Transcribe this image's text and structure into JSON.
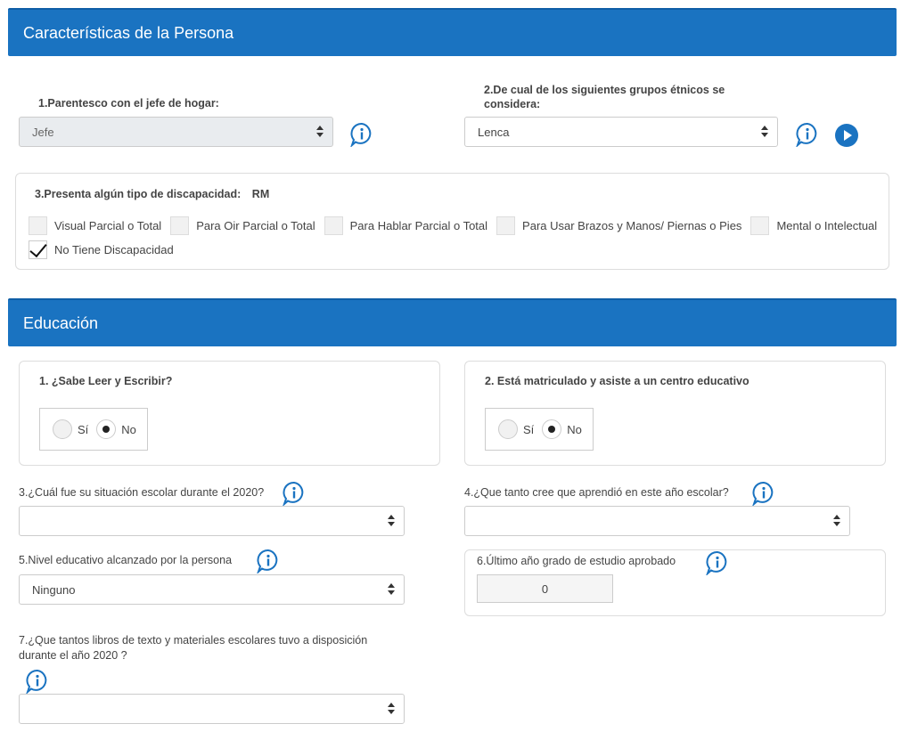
{
  "section1": {
    "title": "Características de la Persona",
    "q1": {
      "label": "1.Parentesco con el jefe de hogar:",
      "value": "Jefe"
    },
    "q2": {
      "label_line1": "2.De cual de los siguientes grupos étnicos se",
      "label_line2": "considera:",
      "value": "Lenca"
    },
    "q3": {
      "label": "3.Presenta algún tipo de discapacidad:",
      "badge": "RM",
      "options": [
        {
          "label": "Visual Parcial o Total",
          "checked": false
        },
        {
          "label": "Para Oir Parcial o Total",
          "checked": false
        },
        {
          "label": "Para Hablar Parcial o Total",
          "checked": false
        },
        {
          "label": "Para Usar Brazos y Manos/ Piernas o Pies",
          "checked": false
        },
        {
          "label": "Mental o Intelectual",
          "checked": false
        },
        {
          "label": "No Tiene Discapacidad",
          "checked": true
        }
      ]
    }
  },
  "section2": {
    "title": "Educación",
    "q1": {
      "label": "1. ¿Sabe Leer y Escribir?",
      "yes": "Sí",
      "no": "No",
      "selected": "No"
    },
    "q2": {
      "label": "2. Está matriculado y asiste a un centro educativo",
      "yes": "Sí",
      "no": "No",
      "selected": "No"
    },
    "q3": {
      "label": "3.¿Cuál fue su situación escolar durante el 2020?",
      "value": ""
    },
    "q4": {
      "label": "4.¿Que tanto cree que aprendió en este año escolar?",
      "value": ""
    },
    "q5": {
      "label": "5.Nivel educativo alcanzado por la persona",
      "value": "Ninguno"
    },
    "q6": {
      "label": "6.Último año grado de estudio aprobado",
      "value": "0"
    },
    "q7": {
      "label_line1": "7.¿Que tantos libros de texto y materiales escolares tuvo a disposición",
      "label_line2": "durante el año 2020 ?",
      "value": ""
    }
  },
  "colors": {
    "header_bg": "#1a73c1",
    "info_icon": "#1a73c1"
  },
  "icons": {
    "info": "info-bubble-icon",
    "play": "play-circle-icon",
    "select_arrow": "updown-caret-icon"
  }
}
